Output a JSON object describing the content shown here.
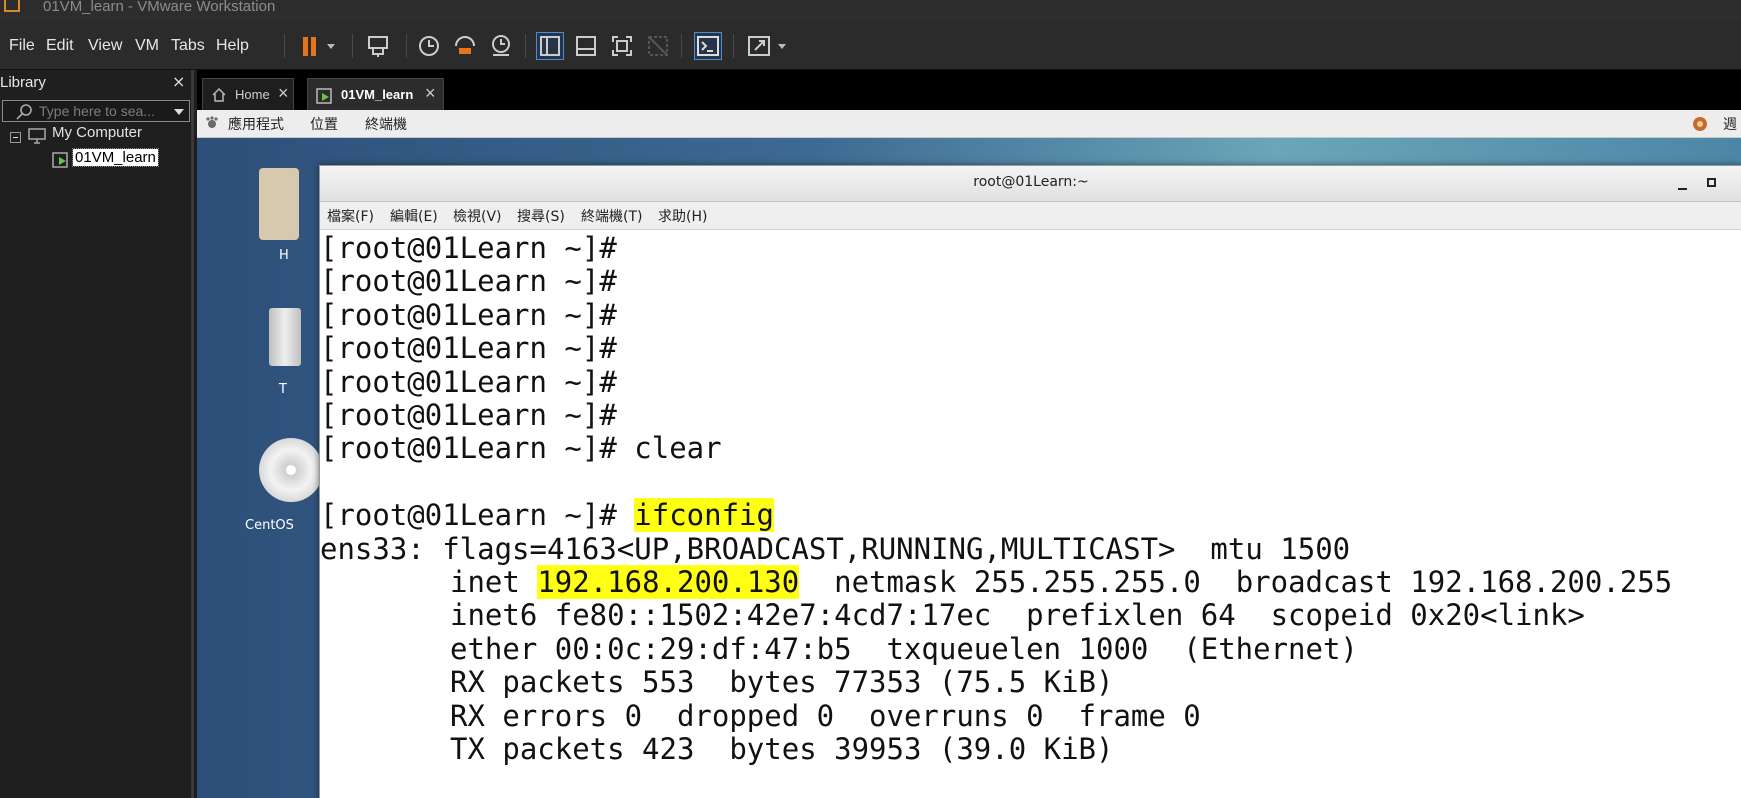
{
  "window": {
    "title": "01VM_learn - VMware Workstation"
  },
  "menubar": {
    "items": [
      "File",
      "Edit",
      "View",
      "VM",
      "Tabs",
      "Help"
    ]
  },
  "library": {
    "title": "Library",
    "close": "×",
    "search_placeholder": "Type here to sea...",
    "tree": {
      "root": "My Computer",
      "vm": "01VM_learn"
    }
  },
  "tabs": [
    {
      "label": "Home",
      "close": "×"
    },
    {
      "label": "01VM_learn",
      "close": "×"
    }
  ],
  "guest_panel": {
    "items": [
      "應用程式",
      "位置",
      "終端機"
    ],
    "right_text": "週"
  },
  "desktop_icons": [
    {
      "label": "H"
    },
    {
      "label": "T"
    },
    {
      "label": "CentOS"
    }
  ],
  "terminal": {
    "title": "root@01Learn:~",
    "menu": [
      "檔案(F)",
      "編輯(E)",
      "檢視(V)",
      "搜尋(S)",
      "終端機(T)",
      "求助(H)"
    ],
    "prompt": "[root@01Learn ~]#",
    "commands": {
      "clear": "clear",
      "ifconfig": "ifconfig"
    },
    "output": {
      "line1": "ens33: flags=4163<UP,BROADCAST,RUNNING,MULTICAST>  mtu 1500",
      "inet_label": "inet ",
      "inet_addr": "192.168.200.130",
      "inet_rest": "  netmask 255.255.255.0  broadcast 192.168.200.255",
      "line3": "inet6 fe80::1502:42e7:4cd7:17ec  prefixlen 64  scopeid 0x20<link>",
      "line4": "ether 00:0c:29:df:47:b5  txqueuelen 1000  (Ethernet)",
      "line5": "RX packets 553  bytes 77353 (75.5 KiB)",
      "line6": "RX errors 0  dropped 0  overruns 0  frame 0",
      "line7": "TX packets 423  bytes 39953 (39.0 KiB)"
    }
  },
  "colors": {
    "highlight": "#ffff14",
    "pause_orange": "#e8741a",
    "tab_vm_green": "#6cc04a"
  }
}
